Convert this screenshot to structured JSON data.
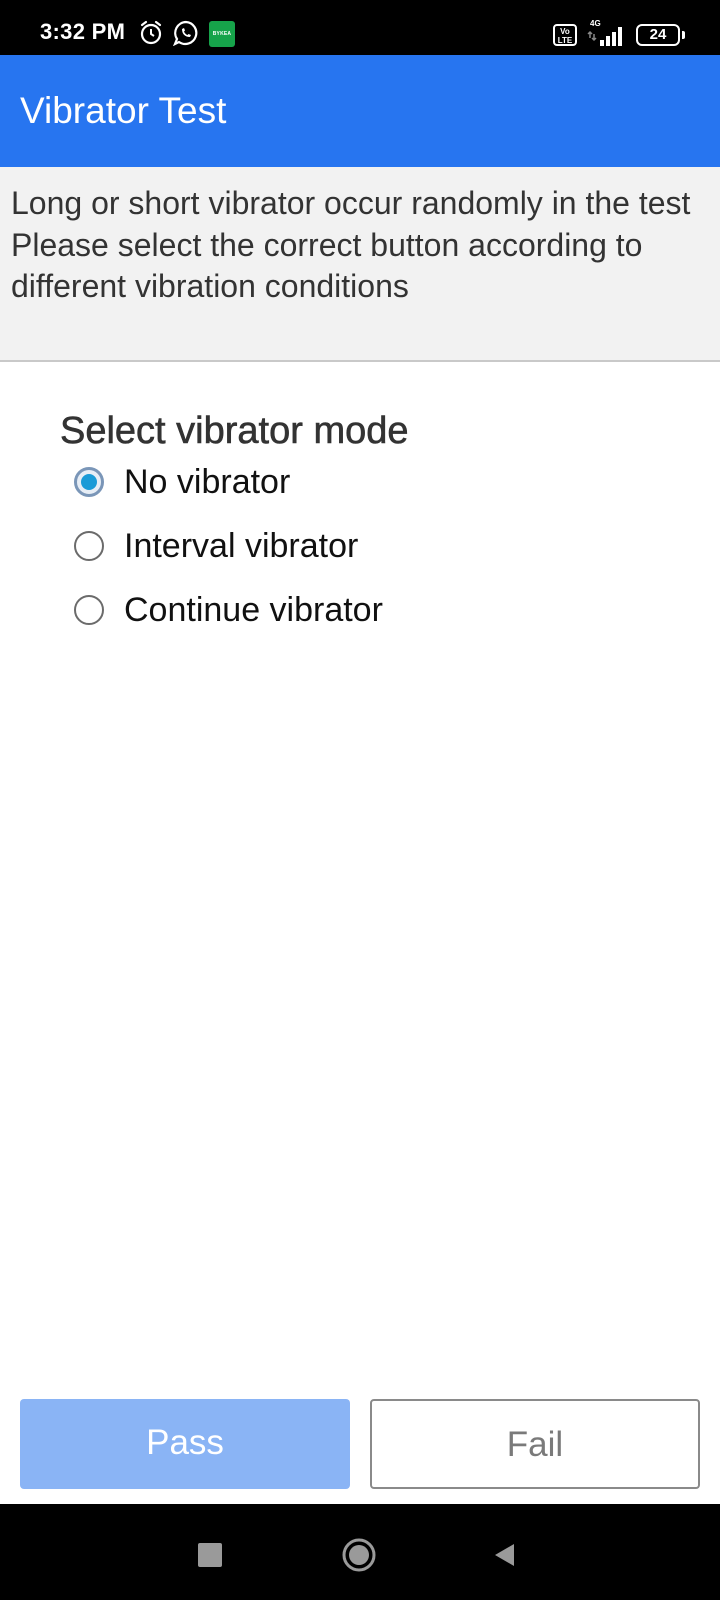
{
  "status_bar": {
    "time": "3:32 PM",
    "app_badge": "BYKEA",
    "volte_label": "Vo LTE",
    "network": "4G",
    "battery": "24",
    "icons": [
      "alarm-icon",
      "whatsapp-icon",
      "bykea-app-icon",
      "volte-icon",
      "signal-icon",
      "battery-icon"
    ]
  },
  "app_bar": {
    "title": "Vibrator Test",
    "color": "#2775f0"
  },
  "description": {
    "line1": "Long or short vibrator occur randomly in the test",
    "line2": "Please select the correct button according to different vibration conditions"
  },
  "mode": {
    "title": "Select vibrator mode",
    "selected": "No vibrator",
    "options": [
      {
        "label": "No vibrator",
        "checked": true
      },
      {
        "label": "Interval vibrator",
        "checked": false
      },
      {
        "label": "Continue vibrator",
        "checked": false
      }
    ]
  },
  "buttons": {
    "pass_label": "Pass",
    "fail_label": "Fail",
    "pass_color": "#8ab4f5"
  },
  "nav_bar": {
    "icons": [
      "recents-icon",
      "home-icon",
      "back-icon"
    ]
  }
}
